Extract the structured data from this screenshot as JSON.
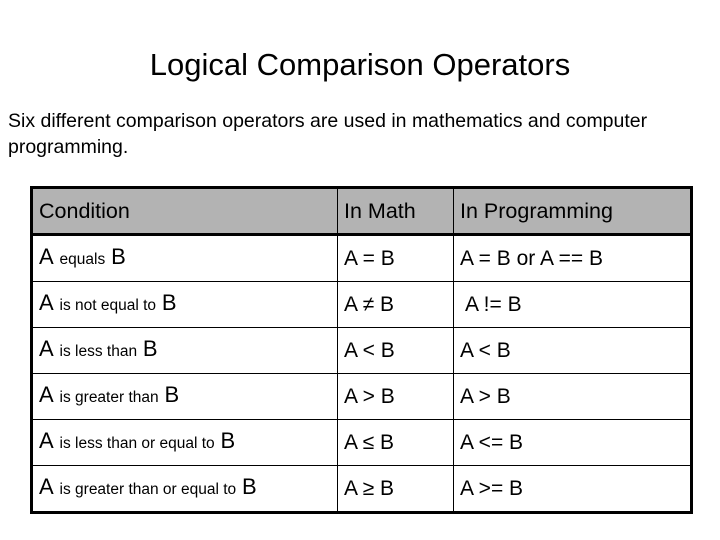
{
  "slide": {
    "title": "Logical Comparison Operators",
    "body": "Six different comparison operators are used in mathematics and computer programming."
  },
  "table": {
    "headers": {
      "condition": "Condition",
      "in_math": "In Math",
      "in_programming": "In Programming"
    },
    "rows": [
      {
        "left_operand": "A",
        "phrase": "equals",
        "right_operand": "B",
        "in_math": "A = B",
        "in_programming": "A = B or A == B"
      },
      {
        "left_operand": "A",
        "phrase": "is not equal to",
        "right_operand": "B",
        "in_math": "A ≠ B",
        "in_programming": "A != B"
      },
      {
        "left_operand": "A",
        "phrase": "is less than",
        "right_operand": "B",
        "in_math": "A < B",
        "in_programming": "A < B"
      },
      {
        "left_operand": "A",
        "phrase": "is greater than",
        "right_operand": "B",
        "in_math": "A > B",
        "in_programming": "A > B"
      },
      {
        "left_operand": "A",
        "phrase": "is less than or equal to",
        "right_operand": "B",
        "in_math": "A ≤ B",
        "in_programming": "A <= B"
      },
      {
        "left_operand": "A",
        "phrase": "is greater than or equal to",
        "right_operand": "B",
        "in_math": "A ≥ B",
        "in_programming": "A >= B"
      }
    ]
  },
  "colors": {
    "header_fill": "#b3b3b3",
    "border": "#000000",
    "text": "#000000",
    "background": "#ffffff"
  }
}
